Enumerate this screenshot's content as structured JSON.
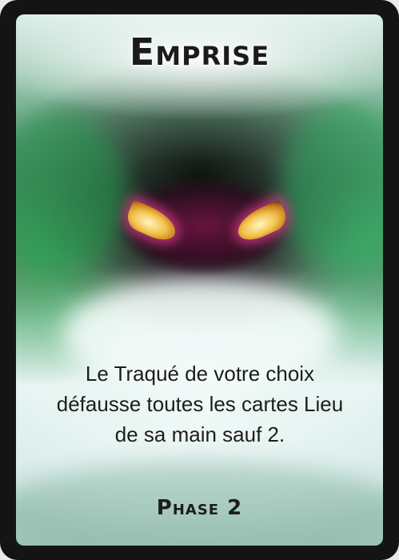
{
  "card": {
    "title": "Emprise",
    "effect_lines": [
      "Le Traqué de votre choix",
      "défausse toutes les cartes Lieu",
      "de sa main sauf 2."
    ],
    "phase": "Phase 2"
  },
  "colors": {
    "border": "#141414",
    "mist_green": "#3a8a5a",
    "eye_glow": "#dc3c8c",
    "eye_iris": "#f2c14a",
    "text": "#1d1d1d"
  }
}
